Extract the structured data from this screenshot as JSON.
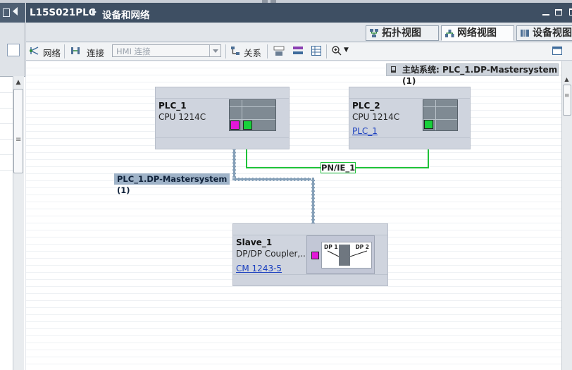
{
  "title_bar": {
    "project": "L15S021PLC",
    "section": "设备和网络"
  },
  "view_tabs": [
    {
      "label": "拓扑视图",
      "icon": "topology-view-icon",
      "active": false
    },
    {
      "label": "网络视图",
      "icon": "network-view-icon",
      "active": true
    },
    {
      "label": "设备视图",
      "icon": "device-view-icon",
      "active": false
    }
  ],
  "toolbar": {
    "network_label": "网络",
    "connection_label": "连接",
    "hmi_select_value": "HMI 连接",
    "relation_label": "关系"
  },
  "master_system_banner": {
    "prefix": "主站系统:",
    "value": "PLC_1.DP-Mastersystem (1)"
  },
  "devices": {
    "plc1": {
      "name": "PLC_1",
      "type": "CPU 1214C"
    },
    "plc2": {
      "name": "PLC_2",
      "type": "CPU 1214C",
      "link": "PLC_1"
    },
    "slave1": {
      "name": "Slave_1",
      "type": "DP/DP Coupler,...",
      "link": "CM 1243-5"
    }
  },
  "networks": {
    "profinet_label": "PN/IE_1",
    "dp_label": "PLC_1.DP-Mastersystem (1)"
  },
  "coupler": {
    "left_port": "DP 1",
    "right_port": "DP 2"
  },
  "colors": {
    "profinet": "#1ec238",
    "profibus_port": "#e317d8",
    "title_bar": "#3e4f63",
    "device_body": "#cfd4de",
    "link_text": "#1a3fbf"
  }
}
